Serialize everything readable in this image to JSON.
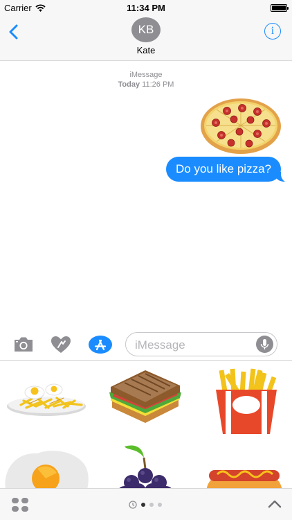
{
  "status_bar": {
    "carrier": "Carrier",
    "time": "11:34 PM"
  },
  "header": {
    "avatar_initials": "KB",
    "contact_name": "Kate"
  },
  "conversation": {
    "service": "iMessage",
    "day": "Today",
    "time": "11:26 PM",
    "sent_sticker": "pizza-sticker",
    "messages": [
      {
        "direction": "outgoing",
        "text": "Do you like pizza?"
      }
    ]
  },
  "composer": {
    "placeholder": "iMessage"
  },
  "sticker_drawer": {
    "stickers": [
      "fried-eggs-and-fries",
      "sandwich",
      "french-fries",
      "fried-egg",
      "grapes",
      "hot-dog"
    ],
    "page_count": 3,
    "active_page": 1
  },
  "colors": {
    "accent": "#1a8cff",
    "bubble_text": "#ffffff",
    "meta_text": "#8e8e93"
  }
}
